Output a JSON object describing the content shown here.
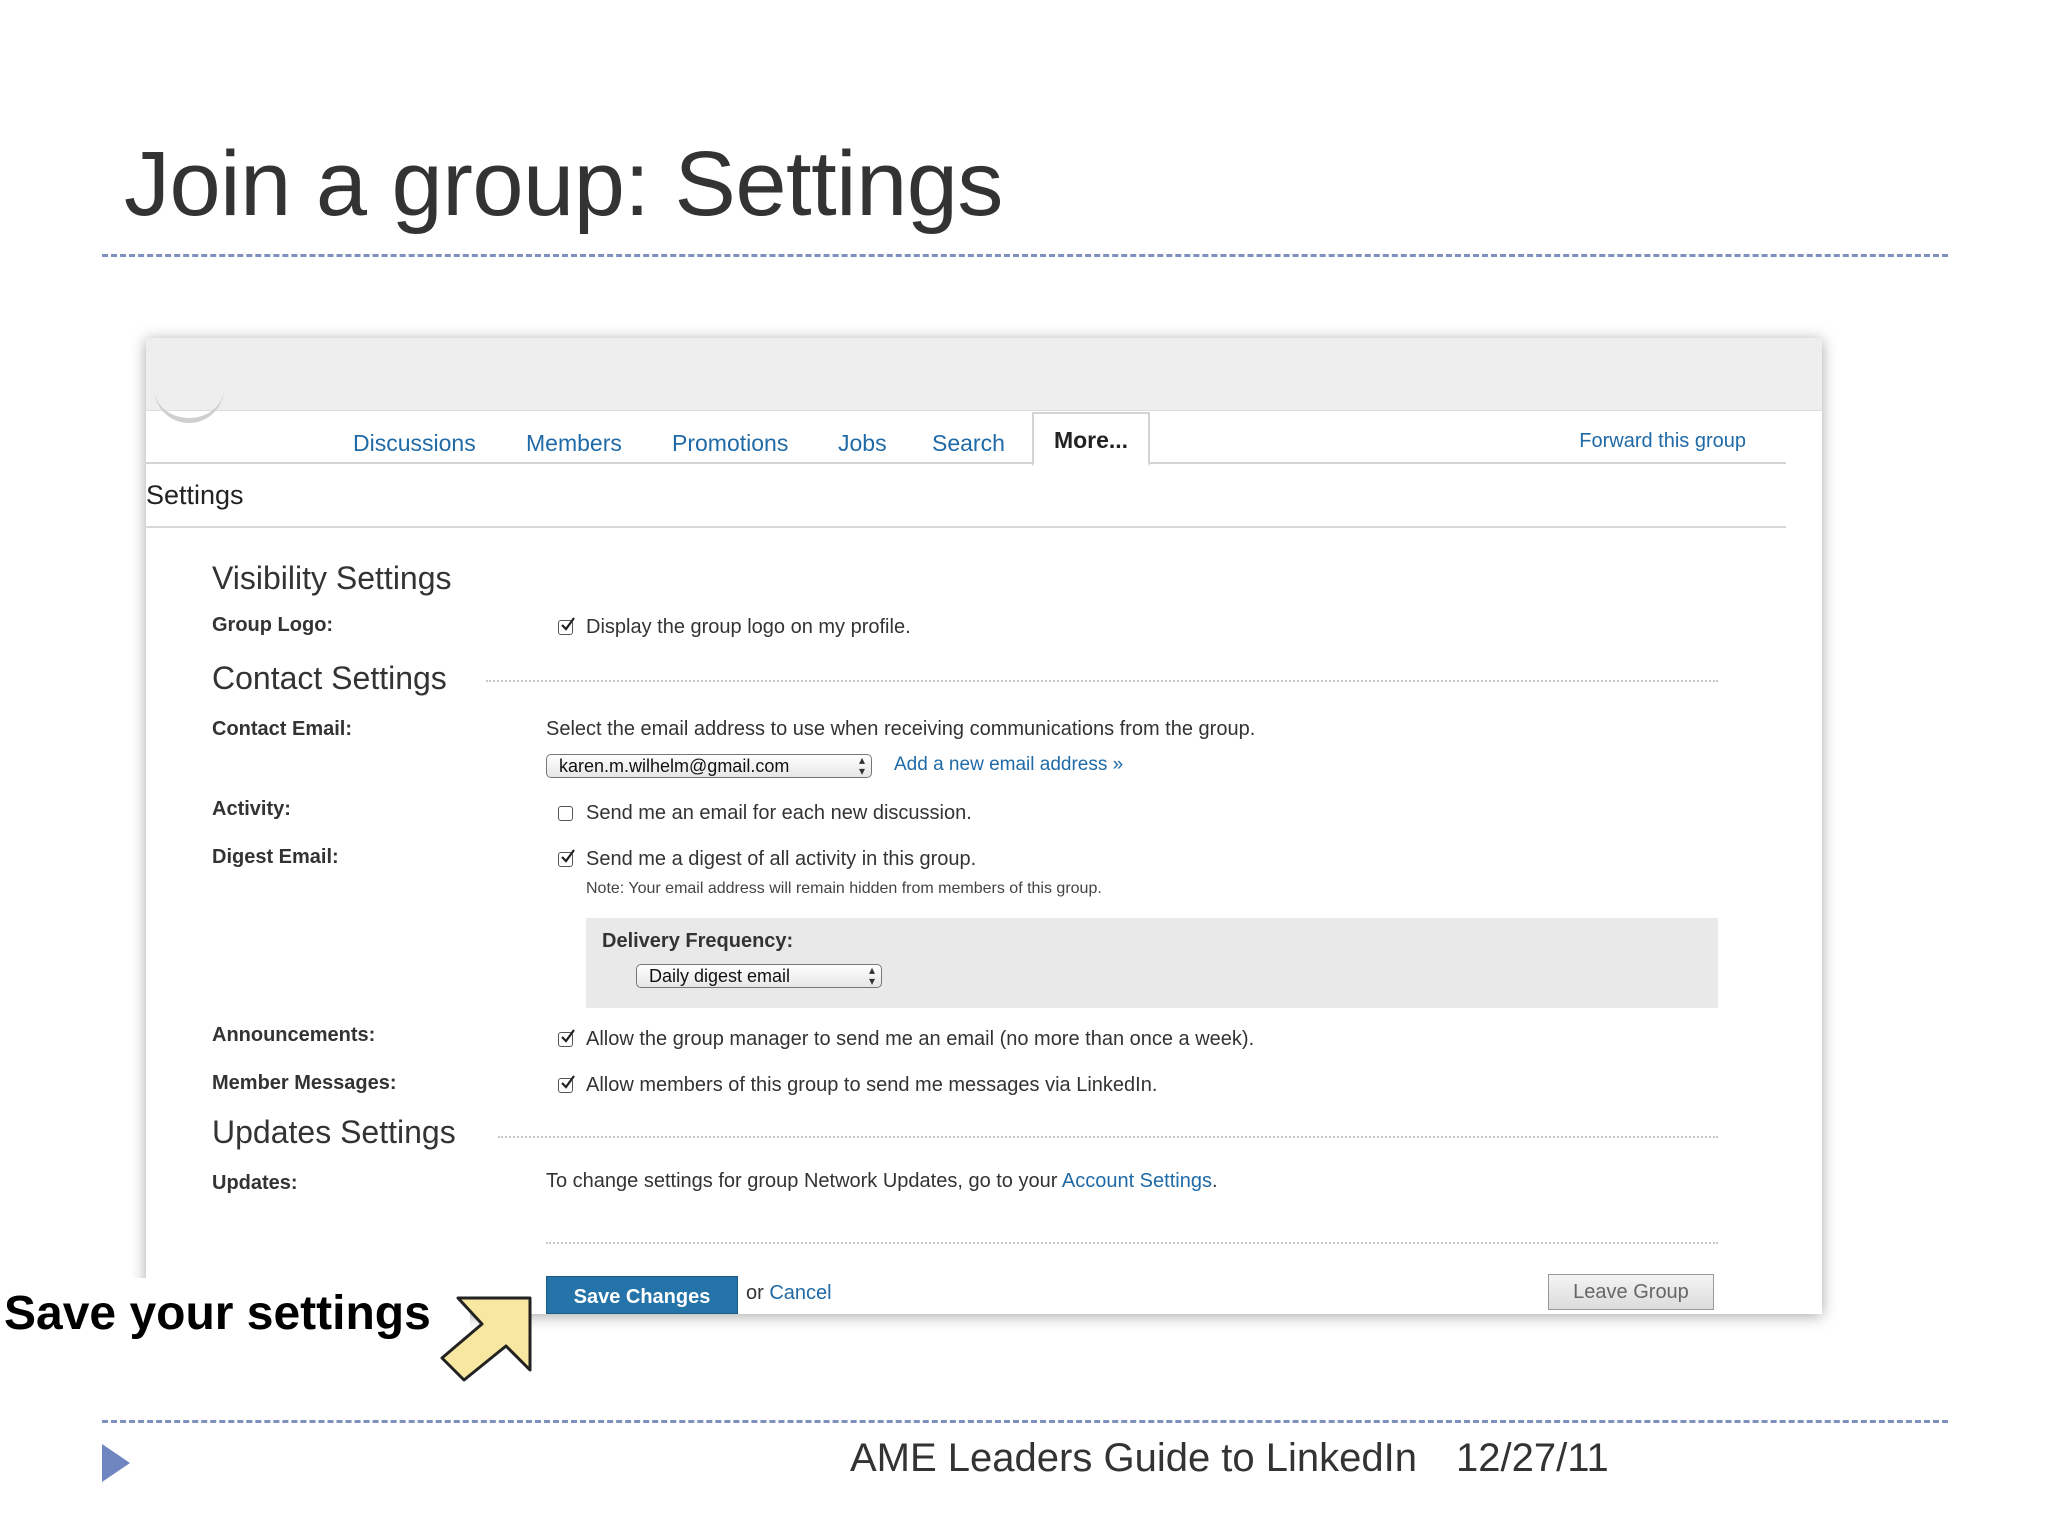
{
  "slide": {
    "title": "Join a group: Settings",
    "callout": "Save your settings",
    "footer_text": "AME Leaders Guide to LinkedIn",
    "footer_date": "12/27/11"
  },
  "nav": {
    "items": [
      "Discussions",
      "Members",
      "Promotions",
      "Jobs",
      "Search"
    ],
    "more": "More...",
    "forward": "Forward this group"
  },
  "page": {
    "title": "Settings"
  },
  "visibility": {
    "title": "Visibility Settings",
    "group_logo_label": "Group Logo:",
    "group_logo_text": "Display the group logo on my profile.",
    "group_logo_checked": true
  },
  "contact": {
    "title": "Contact Settings",
    "email_label": "Contact Email:",
    "email_desc": "Select the email address to use when receiving communications from the group.",
    "email_value": "karen.m.wilhelm@gmail.com",
    "add_email": "Add a new email address »",
    "activity_label": "Activity:",
    "activity_text": "Send me an email for each new discussion.",
    "activity_checked": false,
    "digest_label": "Digest Email:",
    "digest_text": "Send me a digest of all activity in this group.",
    "digest_checked": true,
    "digest_note": "Note: Your email address will remain hidden from members of this group.",
    "freq_label": "Delivery Frequency:",
    "freq_value": "Daily digest email",
    "announce_label": "Announcements:",
    "announce_text": "Allow the group manager to send me an email (no more than once a week).",
    "announce_checked": true,
    "member_msg_label": "Member Messages:",
    "member_msg_text": "Allow members of this group to send me messages via LinkedIn.",
    "member_msg_checked": true
  },
  "updates": {
    "title": "Updates Settings",
    "label": "Updates:",
    "text": "To change settings for group Network Updates, go to your",
    "link": "Account Settings",
    "period": "."
  },
  "actions": {
    "save": "Save Changes",
    "or": "or",
    "cancel": "Cancel",
    "leave": "Leave Group"
  },
  "colors": {
    "link": "#1f6aa7",
    "save_button": "#2574a9",
    "dash": "#7f8fbf",
    "callout_arrow": "#f8e7a0"
  }
}
